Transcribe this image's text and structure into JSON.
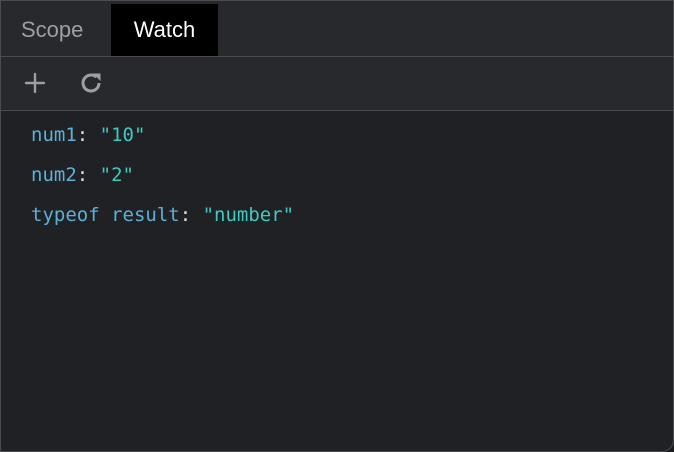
{
  "tabs": {
    "scope_label": "Scope",
    "watch_label": "Watch",
    "active": "Watch"
  },
  "toolbar": {
    "add_icon": "plus-icon",
    "refresh_icon": "refresh-icon"
  },
  "watches": [
    {
      "name": "num1",
      "separator": ": ",
      "value": "\"10\""
    },
    {
      "name": "num2",
      "separator": ": ",
      "value": "\"2\""
    },
    {
      "name": "typeof result",
      "separator": ": ",
      "value": "\"number\""
    }
  ],
  "colors": {
    "panel_bg": "#202124",
    "active_tab_bg": "#000000",
    "name_color": "#5db0d7",
    "value_color": "#3ec9c1"
  }
}
